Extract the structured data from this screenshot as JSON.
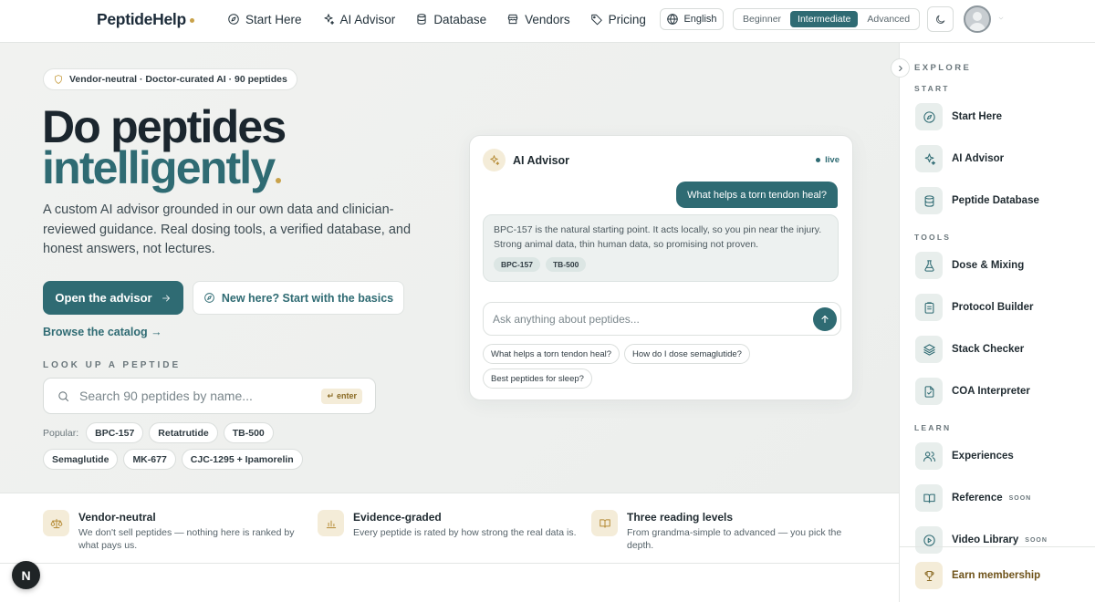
{
  "brand": {
    "name": "PeptideHelp",
    "dot_color": "#c9a24a"
  },
  "nav": [
    {
      "label": "Start Here",
      "icon": "compass-icon"
    },
    {
      "label": "AI Advisor",
      "icon": "sparkles-icon"
    },
    {
      "label": "Database",
      "icon": "database-icon"
    },
    {
      "label": "Vendors",
      "icon": "store-icon"
    },
    {
      "label": "Pricing",
      "icon": "tag-icon"
    }
  ],
  "language": {
    "label": "English"
  },
  "levels": {
    "options": [
      "Beginner",
      "Intermediate",
      "Advanced"
    ],
    "selected": "Intermediate"
  },
  "hero": {
    "badge": "Vendor-neutral · Doctor-curated AI · 90 peptides",
    "title_line1": "Do peptides",
    "title_line2": "intelligently",
    "lead": "A custom AI advisor grounded in our own data and clinician-reviewed guidance. Real dosing tools, a verified database, and honest answers, not lectures.",
    "primary_button": "Open the advisor",
    "secondary_button": "New here? Start with the basics",
    "browse_link": "Browse the catalog →"
  },
  "lookup": {
    "label": "LOOK UP A PEPTIDE",
    "placeholder": "Search 90 peptides by name...",
    "enter_hint": "enter",
    "popular_label": "Popular:",
    "popular": [
      "BPC-157",
      "Retatrutide",
      "TB-500",
      "Semaglutide",
      "MK-677",
      "CJC-1295 + Ipamorelin"
    ]
  },
  "advisor_card": {
    "title": "AI Advisor",
    "status": "live",
    "user_message": "What helps a torn tendon heal?",
    "ai_message": "BPC-157 is the natural starting point. It acts locally, so you pin near the injury. Strong animal data, thin human data, so promising not proven.",
    "ai_tags": [
      "BPC-157",
      "TB-500"
    ],
    "input_placeholder": "Ask anything about peptides...",
    "suggestions": [
      "What helps a torn tendon heal?",
      "How do I dose semaglutide?",
      "Best peptides for sleep?"
    ]
  },
  "features": [
    {
      "title": "Vendor-neutral",
      "desc": "We don't sell peptides — nothing here is ranked by what pays us.",
      "icon": "scale-icon"
    },
    {
      "title": "Evidence-graded",
      "desc": "Every peptide is rated by how strong the real data is.",
      "icon": "bar-chart-icon"
    },
    {
      "title": "Three reading levels",
      "desc": "From grandma-simple to advanced — you pick the depth.",
      "icon": "book-open-icon"
    }
  ],
  "fab_letter": "N",
  "sidebar": {
    "heading": "EXPLORE",
    "sections": {
      "start": "START",
      "tools": "TOOLS",
      "learn": "LEARN"
    },
    "start_items": [
      {
        "label": "Start Here",
        "icon": "compass-icon"
      },
      {
        "label": "AI Advisor",
        "icon": "sparkles-icon"
      },
      {
        "label": "Peptide Database",
        "icon": "database-icon"
      }
    ],
    "tools_items": [
      {
        "label": "Dose & Mixing",
        "icon": "flask-icon"
      },
      {
        "label": "Protocol Builder",
        "icon": "clipboard-icon"
      },
      {
        "label": "Stack Checker",
        "icon": "layers-icon"
      },
      {
        "label": "COA Interpreter",
        "icon": "file-check-icon"
      }
    ],
    "learn_items": [
      {
        "label": "Experiences",
        "icon": "users-icon"
      },
      {
        "label": "Reference",
        "icon": "book-icon",
        "badge": "SOON"
      },
      {
        "label": "Video Library",
        "icon": "play-icon",
        "badge": "SOON"
      }
    ],
    "earn": {
      "label": "Earn membership",
      "icon": "trophy-icon"
    }
  },
  "colors": {
    "accent": "#2f6b73",
    "gold": "#c9a24a",
    "dark": "#1b262e"
  }
}
